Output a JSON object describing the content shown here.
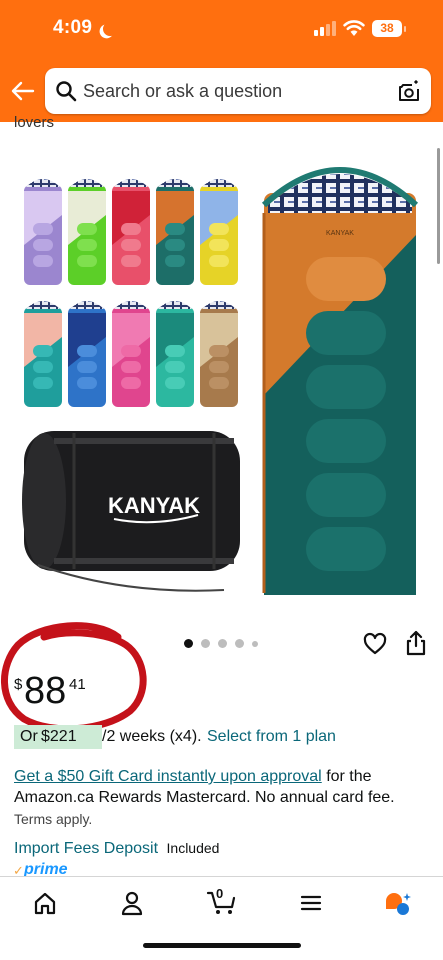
{
  "status_bar": {
    "time": "4:09",
    "battery": "38"
  },
  "search": {
    "placeholder": "Search or ask a question"
  },
  "product": {
    "title_fragment": "lovers",
    "brand_logo": "KANYAK",
    "carousel": {
      "total": 5,
      "active": 1
    }
  },
  "price": {
    "currency": "$",
    "whole": "88",
    "fraction": "41"
  },
  "installment": {
    "or": "Or",
    "amount": "$221",
    "rest": "/2 weeks (x4).",
    "link": "Select from 1 plan"
  },
  "offer": {
    "link": "Get a $50 Gift Card instantly upon approval",
    "text": "for the Amazon.ca Rewards Mastercard. No annual card fee.",
    "terms": "Terms apply."
  },
  "fees": {
    "link": "Import Fees Deposit",
    "included": "Included"
  },
  "prime": {
    "label": "prime"
  },
  "bottom_nav": {
    "cart_count": "0",
    "items": [
      "home-icon",
      "account-icon",
      "cart-icon",
      "menu-icon",
      "assistant-icon"
    ]
  },
  "colors": {
    "header": "#ff6f0f",
    "link": "#0a6779",
    "installment_badge": "#cdebd6",
    "annotation_circle": "#c4121a",
    "prime_blue": "#1a98ff"
  }
}
